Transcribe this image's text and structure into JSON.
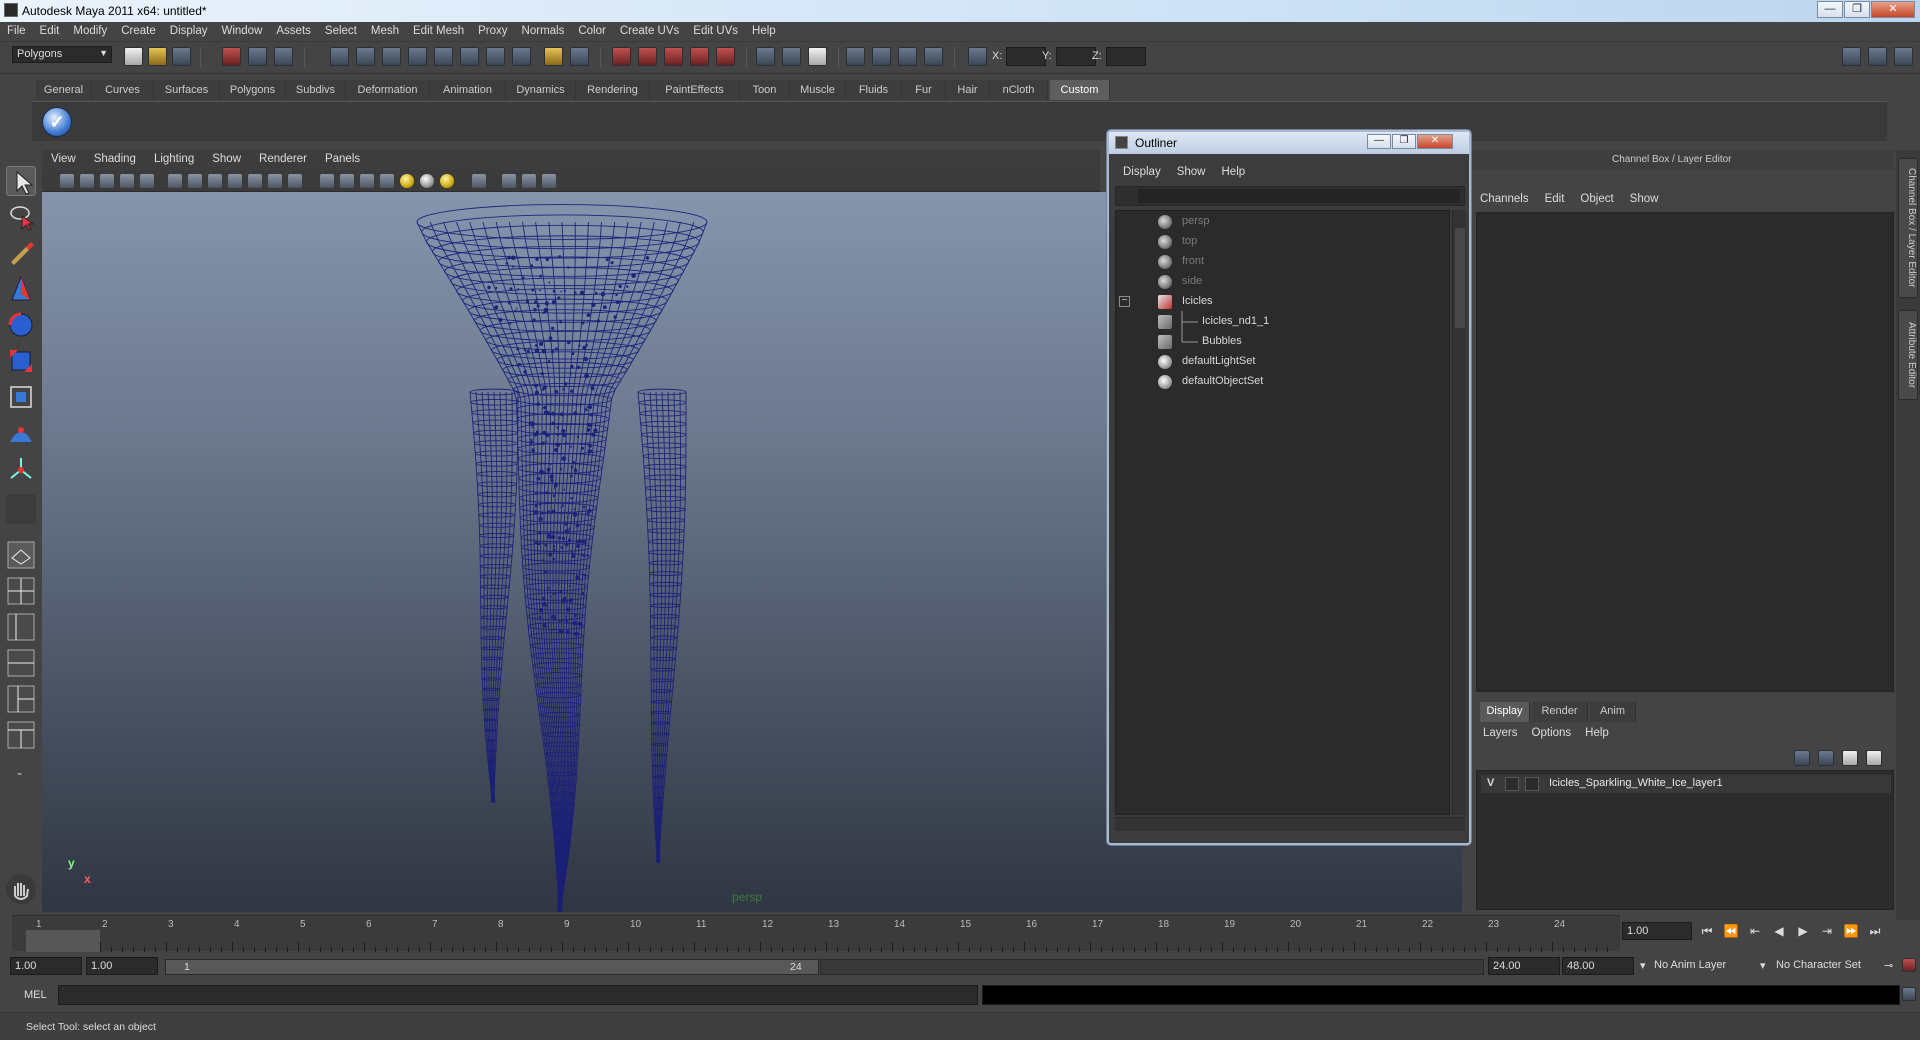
{
  "window": {
    "title": "Autodesk Maya 2011 x64: untitled*"
  },
  "menubar": [
    "File",
    "Edit",
    "Modify",
    "Create",
    "Display",
    "Window",
    "Assets",
    "Select",
    "Mesh",
    "Edit Mesh",
    "Proxy",
    "Normals",
    "Color",
    "Create UVs",
    "Edit UVs",
    "Help"
  ],
  "statusline": {
    "mode": "Polygons",
    "x_label": "X:",
    "y_label": "Y:",
    "z_label": "Z:"
  },
  "shelf": {
    "tabs": [
      "General",
      "Curves",
      "Surfaces",
      "Polygons",
      "Subdivs",
      "Deformation",
      "Animation",
      "Dynamics",
      "Rendering",
      "PaintEffects",
      "Toon",
      "Muscle",
      "Fluids",
      "Fur",
      "Hair",
      "nCloth",
      "Custom"
    ],
    "active_tab": "Custom"
  },
  "viewport": {
    "menu": [
      "View",
      "Shading",
      "Lighting",
      "Show",
      "Renderer",
      "Panels"
    ],
    "camera_label": "persp",
    "axis_y": "y",
    "axis_x": "x",
    "wire_color": "#1a1f7a"
  },
  "outliner": {
    "title": "Outliner",
    "menu": [
      "Display",
      "Show",
      "Help"
    ],
    "items": [
      {
        "label": "persp",
        "dim": true
      },
      {
        "label": "top",
        "dim": true
      },
      {
        "label": "front",
        "dim": true
      },
      {
        "label": "side",
        "dim": true
      },
      {
        "label": "Icicles",
        "dim": false
      },
      {
        "label": "Icicles_nd1_1",
        "dim": false
      },
      {
        "label": "Bubbles",
        "dim": false
      },
      {
        "label": "defaultLightSet",
        "dim": false
      },
      {
        "label": "defaultObjectSet",
        "dim": false
      }
    ],
    "expander_symbol": "−"
  },
  "channelbox": {
    "title": "Channel Box / Layer Editor",
    "menu": [
      "Channels",
      "Edit",
      "Object",
      "Show"
    ],
    "side_tabs": [
      "Channel Box / Layer Editor",
      "Attribute Editor"
    ]
  },
  "layer_editor": {
    "tabs": [
      "Display",
      "Render",
      "Anim"
    ],
    "active_tab": "Display",
    "menu": [
      "Layers",
      "Options",
      "Help"
    ],
    "layer": {
      "visible": "V",
      "name": "Icicles_Sparkling_White_Ice_layer1"
    }
  },
  "timeline": {
    "ticks": [
      "1",
      "2",
      "3",
      "4",
      "5",
      "6",
      "7",
      "8",
      "9",
      "10",
      "11",
      "12",
      "13",
      "14",
      "15",
      "16",
      "17",
      "18",
      "19",
      "20",
      "21",
      "22",
      "23",
      "24"
    ],
    "current_marker": "1",
    "current_frame": "1.00"
  },
  "range": {
    "start": "1.00",
    "playback_start": "1.00",
    "slider_lo": "1",
    "slider_hi": "24",
    "playback_end": "24.00",
    "end": "48.00",
    "anim_layer": "No Anim Layer",
    "character_set": "No Character Set"
  },
  "cmdline": {
    "label": "MEL"
  },
  "helpline": {
    "text": "Select Tool: select an object"
  }
}
